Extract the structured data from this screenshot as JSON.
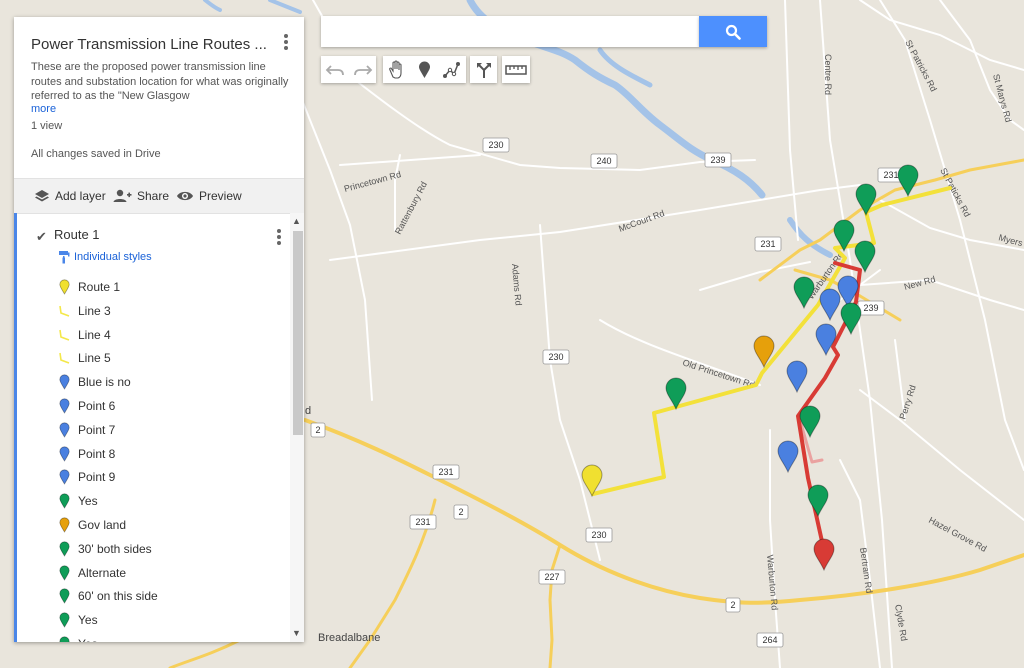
{
  "panel": {
    "title": "Power Transmission Line Routes ...",
    "description": "These are the proposed power transmission line routes and substation location for what was originally referred to as the \"New Glasgow",
    "more_link": "more",
    "views": "1 view",
    "save_status": "All changes saved in Drive",
    "toolbar": {
      "add_layer": "Add layer",
      "share": "Share",
      "preview": "Preview"
    },
    "layer": {
      "name": "Route 1",
      "style_label": "Individual styles",
      "items": [
        {
          "label": "Route 1",
          "icon": "yellow-pin",
          "color": "#f0e030"
        },
        {
          "label": "Line 3",
          "icon": "yellow-line",
          "color": "#f4e84a"
        },
        {
          "label": "Line 4",
          "icon": "yellow-line",
          "color": "#f4e84a"
        },
        {
          "label": "Line 5",
          "icon": "yellow-line",
          "color": "#f4e84a"
        },
        {
          "label": "Blue is no",
          "icon": "blue-pin",
          "color": "#4a80e0"
        },
        {
          "label": "Point 6",
          "icon": "blue-pin",
          "color": "#4a80e0"
        },
        {
          "label": "Point 7",
          "icon": "blue-pin",
          "color": "#4a80e0"
        },
        {
          "label": "Point 8",
          "icon": "blue-pin",
          "color": "#4a80e0"
        },
        {
          "label": "Point 9",
          "icon": "blue-pin",
          "color": "#4a80e0"
        },
        {
          "label": "Yes",
          "icon": "green-pin",
          "color": "#0f9d58"
        },
        {
          "label": "Gov land",
          "icon": "orange-pin",
          "color": "#e6a00b"
        },
        {
          "label": "30' both sides",
          "icon": "green-pin",
          "color": "#0f9d58"
        },
        {
          "label": "Alternate",
          "icon": "green-pin",
          "color": "#0f9d58"
        },
        {
          "label": "60' on this side",
          "icon": "green-pin",
          "color": "#0f9d58"
        },
        {
          "label": "Yes",
          "icon": "green-pin",
          "color": "#0f9d58"
        },
        {
          "label": "Yes",
          "icon": "green-pin",
          "color": "#0f9d58"
        }
      ]
    }
  },
  "search": {
    "value": "",
    "placeholder": ""
  },
  "map_tools": [
    "undo-icon",
    "redo-icon",
    "pan-hand-icon",
    "add-marker-icon",
    "draw-line-icon",
    "directions-icon",
    "measure-ruler-icon"
  ],
  "map": {
    "road_labels": {
      "centre_rd": "Centre Rd",
      "st_patricks_rd": "St Patricks Rd",
      "st_marys_rd": "St Marys Rd",
      "princetown_rd": "Princetown Rd",
      "rattenbury_rd": "Rattenbury Rd",
      "mccourt_rd": "McCourt Rd",
      "adams_rd": "Adams Rd",
      "old_princetown_rd": "Old Princetown Rd",
      "warburton_rd_n": "Warburton Rd",
      "warburton_rd_s": "Warburton Rd",
      "new_rd": "New Rd",
      "myers": "Myers",
      "perry_rd": "Perry Rd",
      "hazel_grove_rd": "Hazel Grove Rd",
      "bertram_rd": "Bertram Rd",
      "clyde_rd": "Clyde Rd",
      "st_paticks_rd": "St Paticks Rd",
      "breadalbane": "Breadalbane",
      "edge_d": "d"
    },
    "shields": [
      "230",
      "240",
      "239",
      "231",
      "231",
      "239",
      "230",
      "2",
      "231",
      "231",
      "2",
      "230",
      "227",
      "2",
      "264",
      "230"
    ],
    "colors": {
      "land": "#e9e5dc",
      "water": "#a4c3e8",
      "major_road": "#f6cf5a",
      "minor_road": "#ffffff",
      "route_yellow": "#f3e13a",
      "route_red": "#d83b35",
      "route_pink": "#eaa2a0",
      "pin_green": "#0f9d58",
      "pin_blue": "#4a80e0",
      "pin_orange": "#e6a00b",
      "pin_yellow": "#f0e030",
      "pin_red": "#d83b35"
    },
    "markers": [
      {
        "type": "yellow-pin",
        "color": "#f0e030"
      },
      {
        "type": "orange-pin",
        "color": "#e6a00b"
      },
      {
        "type": "red-pin",
        "color": "#d83b35"
      },
      {
        "type": "green-pin",
        "color": "#0f9d58"
      },
      {
        "type": "blue-pin",
        "color": "#4a80e0"
      }
    ]
  }
}
